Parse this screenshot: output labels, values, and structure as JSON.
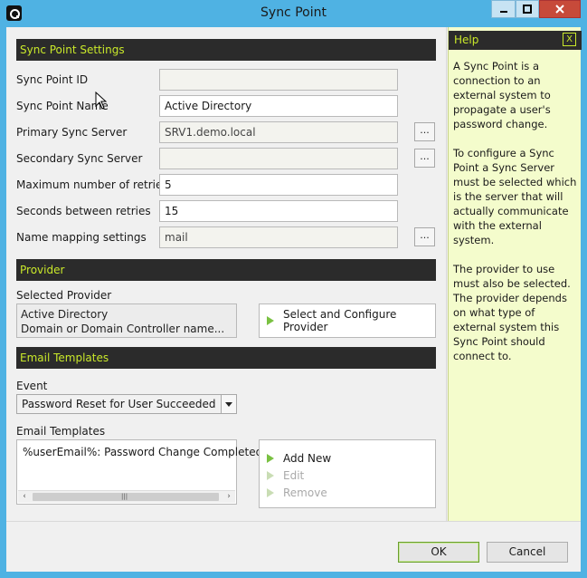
{
  "window": {
    "title": "Sync Point"
  },
  "settings": {
    "header": "Sync Point Settings",
    "fields": {
      "sync_point_id": {
        "label": "Sync Point ID",
        "value": ""
      },
      "sync_point_name": {
        "label": "Sync Point Name",
        "value": "Active Directory"
      },
      "primary_sync_server": {
        "label": "Primary Sync Server",
        "value": "SRV1.demo.local"
      },
      "secondary_sync_server": {
        "label": "Secondary Sync Server",
        "value": ""
      },
      "max_retries": {
        "label": "Maximum number of retries",
        "value": "5"
      },
      "seconds_between_retries": {
        "label": "Seconds between retries",
        "value": "15"
      },
      "name_mapping": {
        "label": "Name mapping settings",
        "value": "mail"
      }
    },
    "browse_label": "..."
  },
  "provider": {
    "header": "Provider",
    "selected_label": "Selected Provider",
    "selected_line1": "Active Directory",
    "selected_line2": "Domain or Domain Controller name...",
    "configure_button": "Select and Configure Provider"
  },
  "email": {
    "header": "Email Templates",
    "event_label": "Event",
    "event_value": "Password Reset for User Succeeded",
    "templates_label": "Email Templates",
    "templates": [
      "%userEmail%: Password Change Completed"
    ],
    "actions": {
      "add": "Add New",
      "edit": "Edit",
      "remove": "Remove"
    }
  },
  "help": {
    "header": "Help",
    "close": "X",
    "paragraphs": [
      "A Sync Point is a connection to an external system to propagate a user's password change.",
      "To configure a Sync Point a Sync Server must be selected which is the server that will actually communicate with the external system.",
      "The provider to use must also be selected. The provider depends on what type of external system this Sync Point should connect to."
    ]
  },
  "footer": {
    "ok": "OK",
    "cancel": "Cancel"
  },
  "colors": {
    "titlebar": "#4fb2e3",
    "section_bar": "#2b2b2b",
    "section_text": "#c9e82a",
    "help_bg": "#f4fccc",
    "action_icon": "#7ac142"
  }
}
